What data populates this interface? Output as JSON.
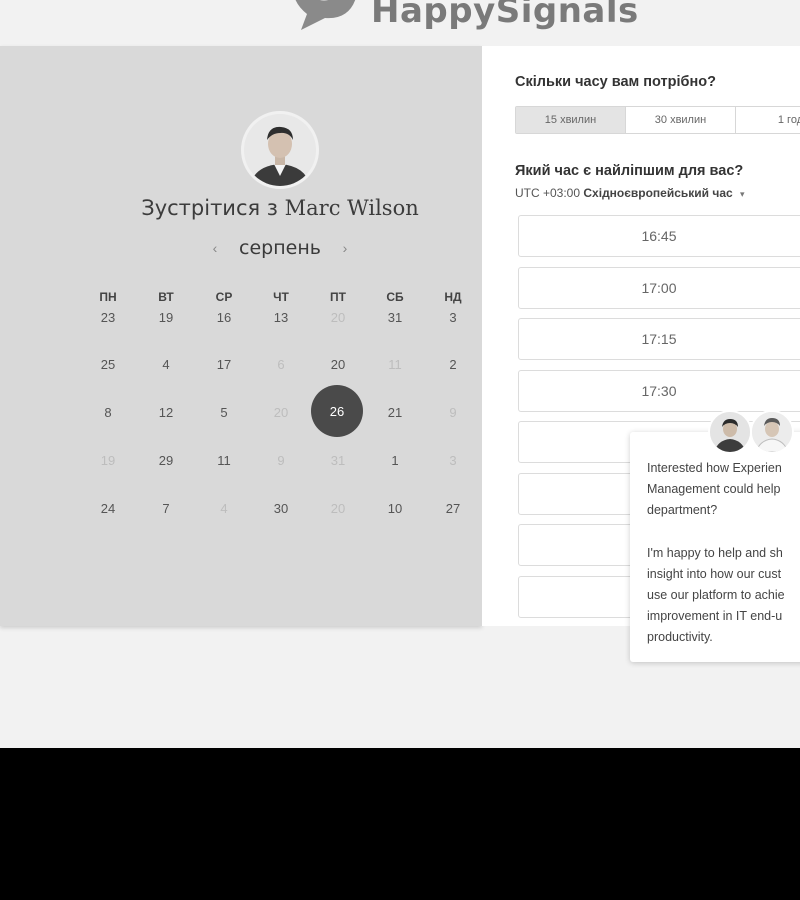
{
  "brand": {
    "name": "HappySignals"
  },
  "scheduler": {
    "meet_prefix": "Зустрітися з ",
    "host_name": "Marc Wilson",
    "month": "серпень",
    "prev_icon": "‹",
    "next_icon": "›",
    "weekdays": [
      "ПН",
      "ВТ",
      "СР",
      "ЧТ",
      "ПТ",
      "СБ",
      "НД"
    ],
    "rows": [
      [
        "23",
        "19",
        "16",
        "13",
        "20",
        "31",
        "3"
      ],
      [
        "25",
        "4",
        "17",
        "6",
        "20",
        "11",
        "2"
      ],
      [
        "8",
        "12",
        "5",
        "20",
        "26",
        "21",
        "9"
      ],
      [
        "19",
        "29",
        "11",
        "9",
        "31",
        "1",
        "3"
      ],
      [
        "24",
        "7",
        "4",
        "30",
        "20",
        "10",
        "27"
      ]
    ],
    "selected_day": "26"
  },
  "booking": {
    "duration_question": "Скільки часу вам потрібно?",
    "durations": [
      "15 хвилин",
      "30 хвилин",
      "1 год"
    ],
    "time_question": "Який час є найліпшим для вас?",
    "timezone_offset": "UTC +03:00",
    "timezone_name": "Східноєвропейський час",
    "caret": "▾",
    "slots": [
      "16:45",
      "17:00",
      "17:15",
      "17:30",
      "",
      "",
      ""
    ]
  },
  "chat": {
    "lines_a": [
      "Interested how Experien",
      "Management could help",
      "department?"
    ],
    "lines_b": [
      "I'm happy to help and sh",
      "insight into how our cust",
      "use our platform to achie",
      "improvement in IT end-u",
      "productivity."
    ]
  },
  "colors": {
    "selected_day_bg": "#4a4a4a",
    "left_panel_bg": "#d9d9d9"
  }
}
